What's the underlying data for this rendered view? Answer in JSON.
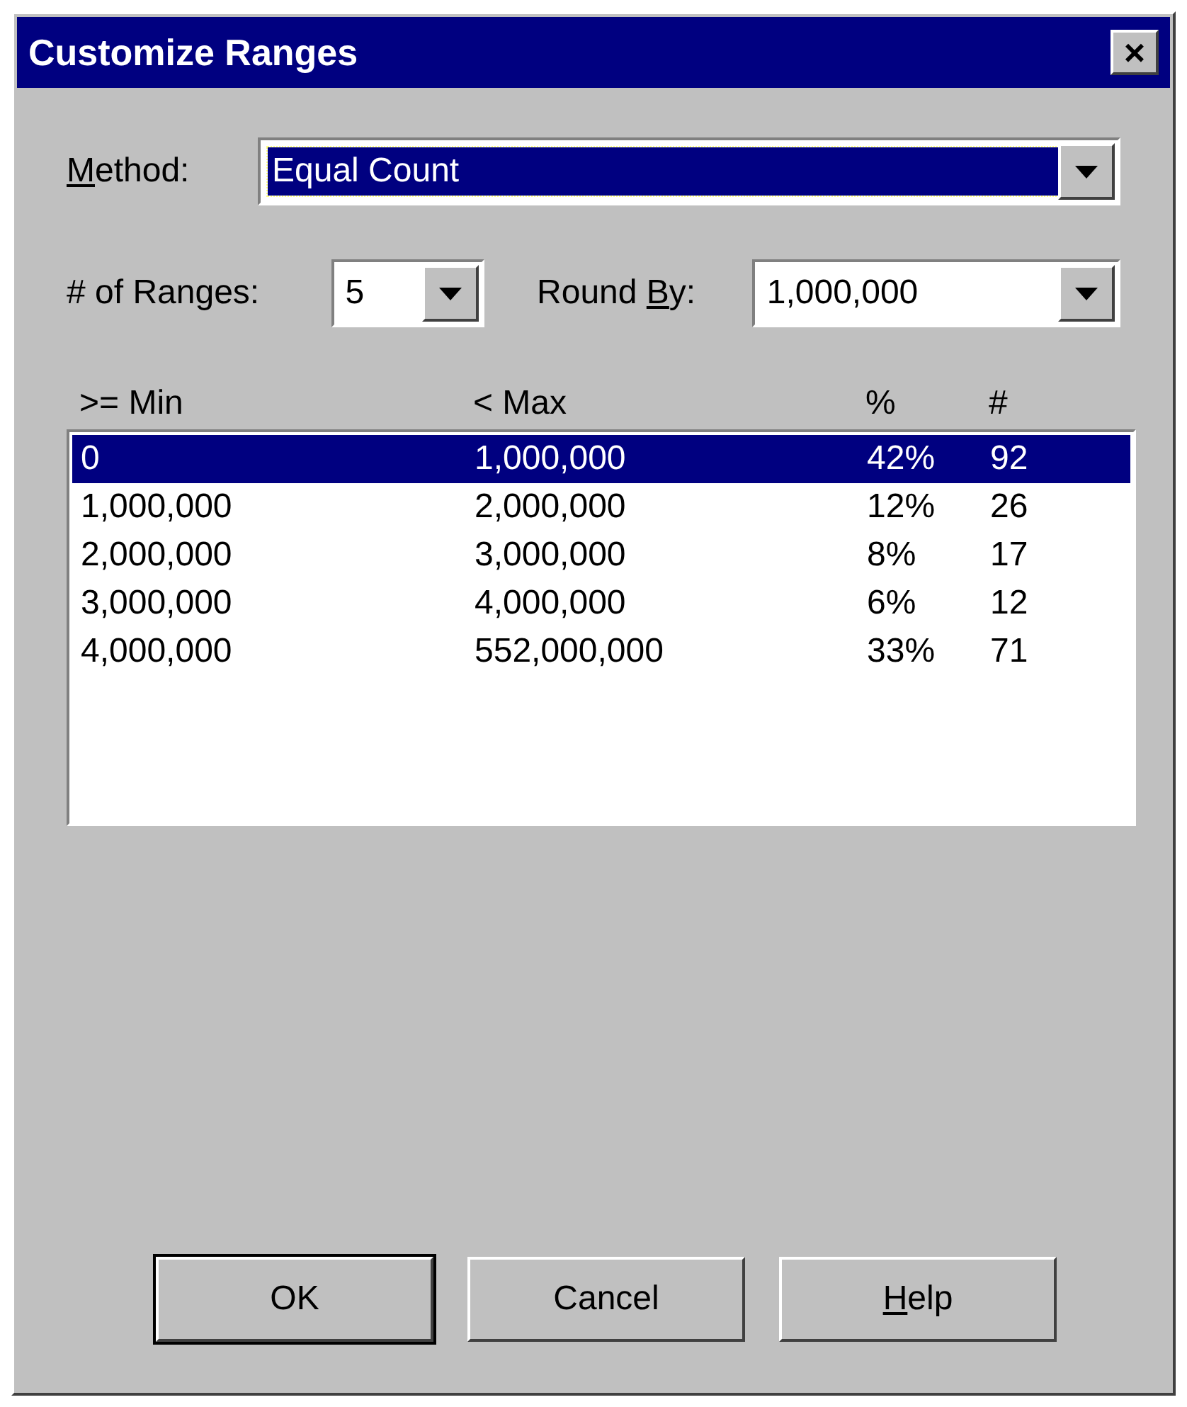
{
  "window": {
    "title": "Customize Ranges",
    "close": "×"
  },
  "method": {
    "label": {
      "key": "M",
      "after": "ethod:"
    },
    "value": "Equal Count",
    "focused": true
  },
  "ranges": {
    "label": {
      "before": "# of Ranges:"
    },
    "value": "5"
  },
  "round_by": {
    "label": {
      "before": "Round ",
      "key": "B",
      "after": "y:"
    },
    "value": "1,000,000"
  },
  "table": {
    "columns": [
      ">= Min",
      "< Max",
      "%",
      "#"
    ],
    "rows": [
      {
        "cells": [
          "0",
          "1,000,000",
          "42%",
          "92"
        ],
        "selected": true
      },
      {
        "cells": [
          "1,000,000",
          "2,000,000",
          "12%",
          "26"
        ],
        "selected": false
      },
      {
        "cells": [
          "2,000,000",
          "3,000,000",
          "8%",
          "17"
        ],
        "selected": false
      },
      {
        "cells": [
          "3,000,000",
          "4,000,000",
          "6%",
          "12"
        ],
        "selected": false
      },
      {
        "cells": [
          "4,000,000",
          "552,000,000",
          "33%",
          "71"
        ],
        "selected": false
      }
    ]
  },
  "buttons": [
    {
      "before": "OK"
    },
    {
      "before": "Cancel"
    },
    {
      "key": "H",
      "after": "elp"
    }
  ]
}
